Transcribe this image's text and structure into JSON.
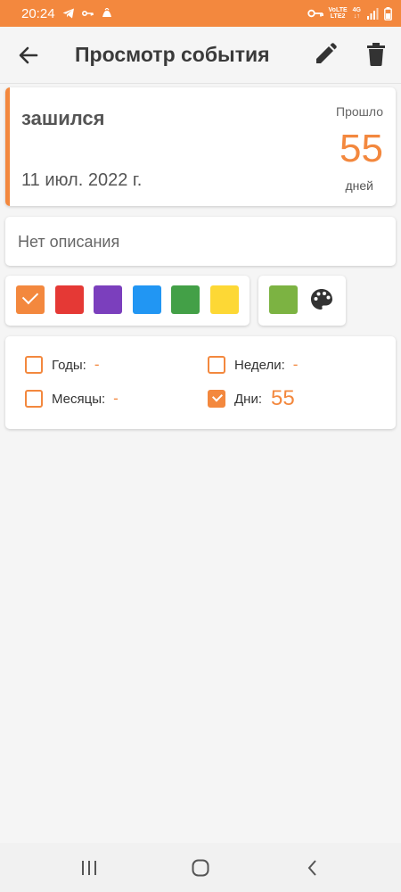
{
  "status_bar": {
    "time": "20:24",
    "carrier_top": "VoLTE",
    "carrier_bottom": "LTE2",
    "net_top": "4G",
    "net_bottom": "↓↑"
  },
  "app_bar": {
    "title": "Просмотр события"
  },
  "event": {
    "title": "зашился",
    "date": "11 июл. 2022 г.",
    "passed_label": "Прошло",
    "count": "55",
    "unit": "дней"
  },
  "description": "Нет описания",
  "colors": {
    "swatches": [
      "#f3883e",
      "#e53935",
      "#7b3fbd",
      "#2196f3",
      "#43a047",
      "#fdd835"
    ],
    "selected": "#f3883e",
    "custom": "#7cb342",
    "icon": "palette-icon"
  },
  "units": [
    {
      "label": "Годы:",
      "value": "-",
      "checked": false
    },
    {
      "label": "Недели:",
      "value": "-",
      "checked": false
    },
    {
      "label": "Месяцы:",
      "value": "-",
      "checked": false
    },
    {
      "label": "Дни:",
      "value": "55",
      "checked": true
    }
  ],
  "accent_color": "#f3883e"
}
